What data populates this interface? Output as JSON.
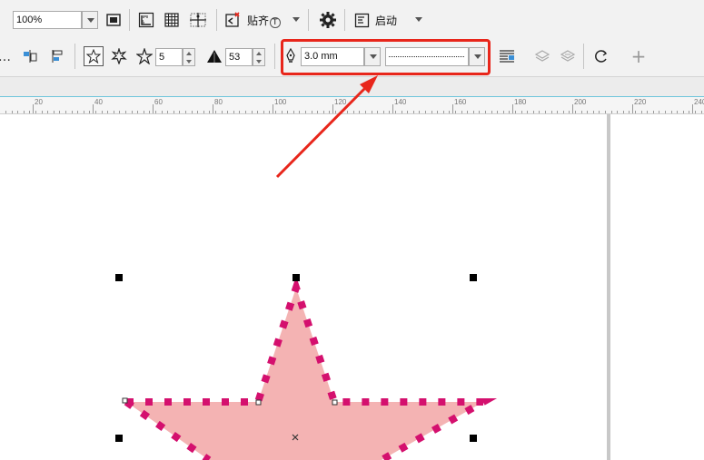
{
  "toolbar_top": {
    "zoom_value": "100%",
    "snap_label": "贴齐",
    "snap_shortcut": "T",
    "launch_label": "启动"
  },
  "property_bar": {
    "points_value": "5",
    "sharpness_value": "53",
    "outline_width_value": "3.0 mm",
    "plus_label": "+"
  },
  "ruler": {
    "labels": [
      "20",
      "40",
      "60",
      "80",
      "100",
      "120",
      "140",
      "160",
      "180",
      "200",
      "220",
      "240"
    ]
  },
  "colors": {
    "highlight_box": "#e8261b",
    "arrow": "#e8261b",
    "star_fill": "#f4b3b3",
    "star_outline_dots": "#d4106e",
    "ruler_accent": "#6ec6dc"
  },
  "icons": {
    "fullscreen": "fullscreen-icon",
    "ruler_toggle": "ruler-icon",
    "grid_toggle": "grid-icon",
    "guidelines": "guidelines-icon",
    "snap": "snap-icon",
    "options": "gear-icon",
    "launch": "launch-icon",
    "polygon": "star-outline-icon",
    "complex_star": "complex-star-icon",
    "star": "star-icon",
    "sharpness": "triangle-icon",
    "pen": "pen-icon",
    "wrap": "wrap-text-icon",
    "to_front": "layer-front-icon",
    "to_back": "layer-back-icon",
    "convert": "convert-curve-icon"
  }
}
